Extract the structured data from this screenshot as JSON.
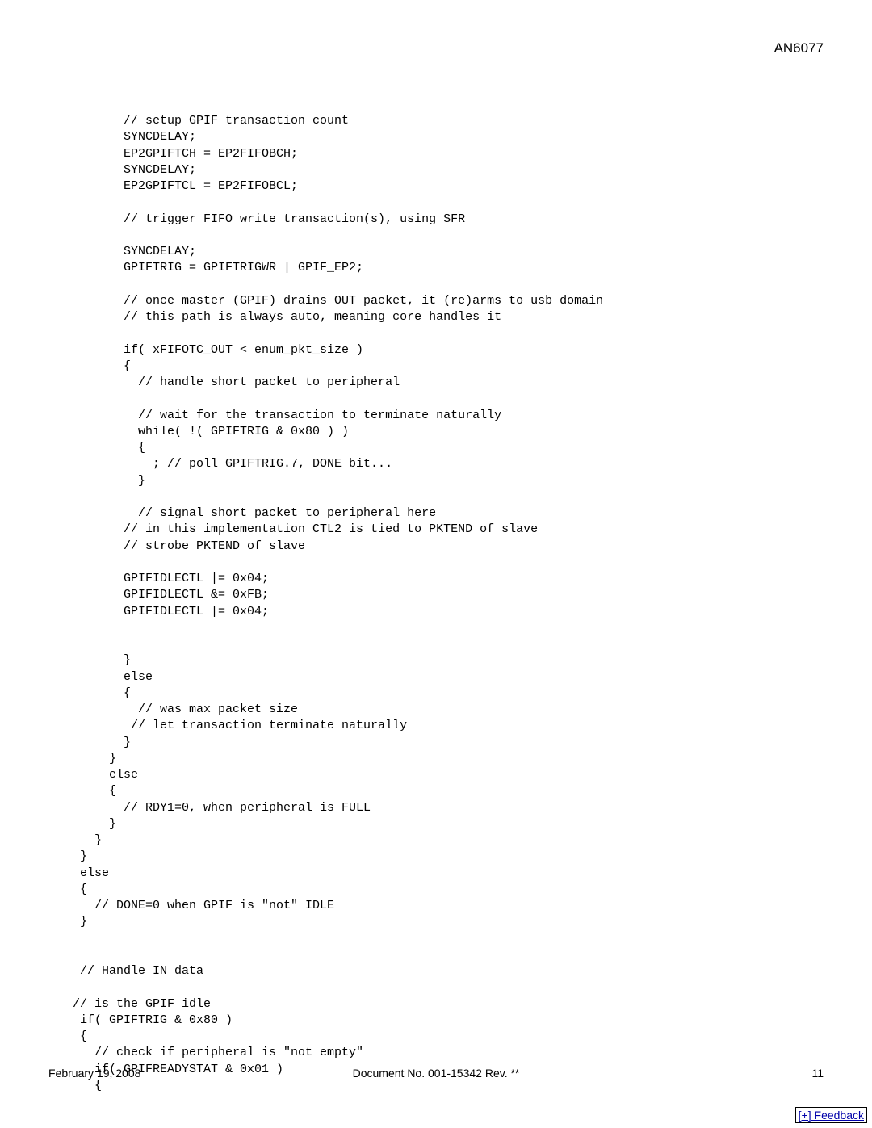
{
  "header": {
    "doc_id": "AN6077"
  },
  "code": "       // setup GPIF transaction count\n       SYNCDELAY;\n       EP2GPIFTCH = EP2FIFOBCH;\n       SYNCDELAY;\n       EP2GPIFTCL = EP2FIFOBCL;\n\n       // trigger FIFO write transaction(s), using SFR\n\n       SYNCDELAY;\n       GPIFTRIG = GPIFTRIGWR | GPIF_EP2;\n\n       // once master (GPIF) drains OUT packet, it (re)arms to usb domain\n       // this path is always auto, meaning core handles it\n\n       if( xFIFOTC_OUT < enum_pkt_size )\n       {\n         // handle short packet to peripheral\n\n         // wait for the transaction to terminate naturally\n         while( !( GPIFTRIG & 0x80 ) )\n         {\n           ; // poll GPIFTRIG.7, DONE bit...\n         }\n\n         // signal short packet to peripheral here\n       // in this implementation CTL2 is tied to PKTEND of slave\n       // strobe PKTEND of slave\n\n       GPIFIDLECTL |= 0x04;\n       GPIFIDLECTL &= 0xFB;\n       GPIFIDLECTL |= 0x04;\n\n\n       }\n       else\n       {\n         // was max packet size\n        // let transaction terminate naturally\n       }\n     }\n     else\n     {\n       // RDY1=0, when peripheral is FULL\n     }\n   }\n }\n else\n {\n   // DONE=0 when GPIF is \"not\" IDLE\n }\n\n\n // Handle IN data\n\n// is the GPIF idle\n if( GPIFTRIG & 0x80 )\n {\n   // check if peripheral is \"not empty\"\n   if( GPIFREADYSTAT & 0x01 )\n   {",
  "footer": {
    "date": "February 19, 2008",
    "doc_number": "Document No. 001-15342 Rev. **",
    "page": "11"
  },
  "feedback": {
    "label": "[+] Feedback"
  }
}
